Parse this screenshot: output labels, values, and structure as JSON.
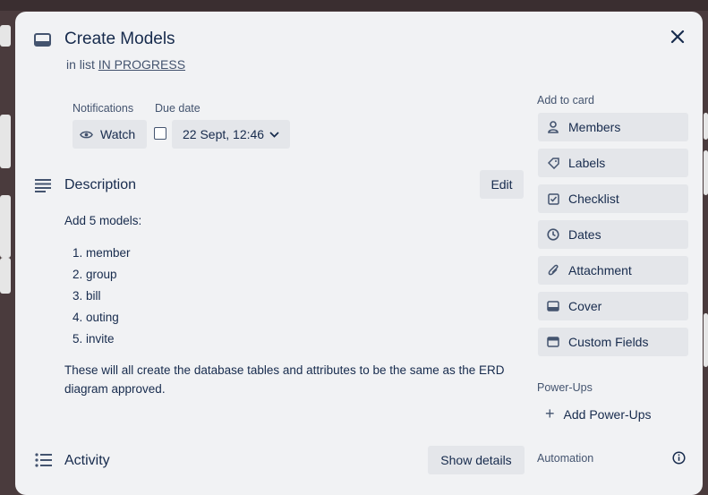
{
  "card": {
    "title": "Create Models",
    "list_prefix": "in list",
    "list_name": "IN PROGRESS"
  },
  "notifications": {
    "label": "Notifications",
    "watch": "Watch"
  },
  "due_date": {
    "label": "Due date",
    "value": "22 Sept, 12:46"
  },
  "description": {
    "heading": "Description",
    "edit": "Edit",
    "intro": "Add 5 models:",
    "items": [
      "member",
      "group",
      "bill",
      "outing",
      "invite"
    ],
    "outro": "These will all create the database tables and attributes to be the same as the ERD diagram approved."
  },
  "activity": {
    "heading": "Activity",
    "show_details": "Show details"
  },
  "sidebar": {
    "add_to_card": "Add to card",
    "buttons": [
      {
        "label": "Members",
        "icon": "person-icon"
      },
      {
        "label": "Labels",
        "icon": "tag-icon"
      },
      {
        "label": "Checklist",
        "icon": "checkbox-icon"
      },
      {
        "label": "Dates",
        "icon": "clock-icon"
      },
      {
        "label": "Attachment",
        "icon": "paperclip-icon"
      },
      {
        "label": "Cover",
        "icon": "cover-icon"
      },
      {
        "label": "Custom Fields",
        "icon": "custom-fields-icon"
      }
    ],
    "powerups_label": "Power-Ups",
    "add_powerups": "Add Power-Ups",
    "automation_label": "Automation"
  }
}
